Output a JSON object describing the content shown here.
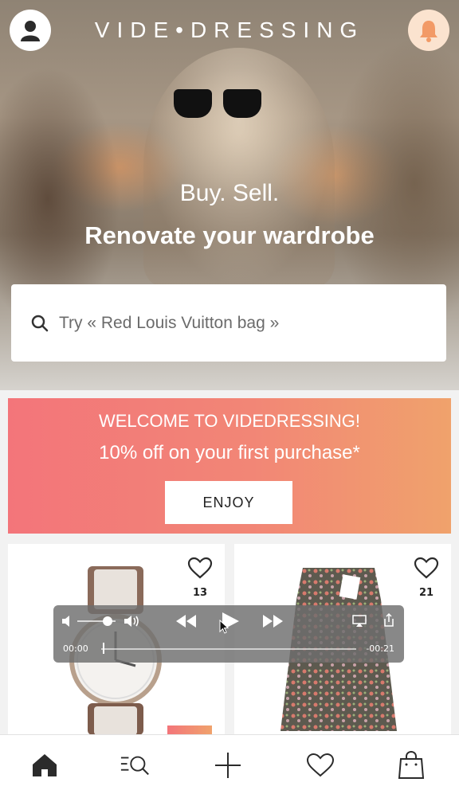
{
  "header": {
    "logo": "VIDE•DRESSING"
  },
  "hero": {
    "line1": "Buy. Sell.",
    "line2": "Renovate your wardrobe"
  },
  "search": {
    "placeholder": "Try « Red Louis Vuitton bag »"
  },
  "promo": {
    "title": "WELCOME TO VIDEDRESSING!",
    "subtitle": "10% off on your first purchase*",
    "button": "ENJOY"
  },
  "products": [
    {
      "likes": "13",
      "item_icon": "watch-image"
    },
    {
      "likes": "21",
      "item_icon": "skirt-image"
    }
  ],
  "player": {
    "elapsed": "00:00",
    "remaining": "-00:21",
    "volume_fraction": 0.8
  },
  "nav": {
    "items": [
      "home-icon",
      "search-list-icon",
      "plus-icon",
      "heart-icon",
      "bag-icon"
    ]
  },
  "colors": {
    "promo_start": "#f3757a",
    "promo_end": "#f0a26c",
    "bell_bg": "#fbe3cf",
    "bell_fg": "#f29a66"
  }
}
